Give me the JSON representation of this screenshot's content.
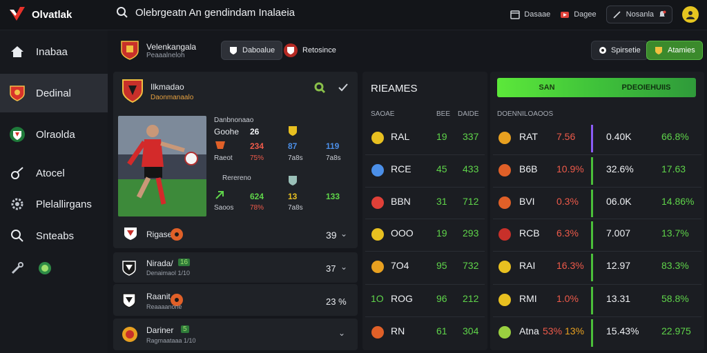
{
  "brand": {
    "name": "Olvatlak"
  },
  "search": {
    "text": "Olebrgeatn An gendindam Inalaeia"
  },
  "top_right": {
    "item1": "Dasaae",
    "item2": "Dagee",
    "item3": "Nosanla"
  },
  "sidebar": {
    "items": [
      {
        "label": "Inabaa"
      },
      {
        "label": "Dedinal"
      },
      {
        "label": "Olraolda"
      },
      {
        "label": "Atocel"
      },
      {
        "label": "Plelallirgans"
      },
      {
        "label": "Snteabs"
      },
      {
        "label": ""
      }
    ]
  },
  "subhead": {
    "team_name": "Velenkangala",
    "team_sub": "Peaaalneloh",
    "pill_active": "Daboalue",
    "pill2": "Retosince",
    "btn_dark": "Spirsetie",
    "btn_green": "Atamies"
  },
  "match_card": {
    "title": "Ilkmadao",
    "subtitle": "Daonmanaalo",
    "stats_header": "Danbnonaao",
    "goals_label": "Goohe",
    "goals_value": "26",
    "label_a": "Raeot",
    "label_b": "Saoos",
    "top_vals": [
      "234",
      "87",
      "119"
    ],
    "top_subs": [
      "75%",
      "7a8s",
      "7a8s"
    ],
    "bottom_header": "Rerereno",
    "bottom_vals": [
      "624",
      "13",
      "133"
    ],
    "bottom_subs": [
      "78%",
      "7a8s",
      ""
    ],
    "footer_label": "Rigase",
    "footer_value": "39"
  },
  "match_rows": [
    {
      "title": "Nirada/",
      "badge": "16",
      "sub": "Denaimaol 1/10",
      "value": "37"
    },
    {
      "title": "Raanit",
      "badge": "",
      "sub": "Reaaaanone",
      "value": "23 %"
    },
    {
      "title": "Dariner",
      "badge": "5",
      "sub": "Ragmaataaa 1/10",
      "value": ""
    }
  ],
  "mid_table": {
    "title": "RIEAMES",
    "headers": [
      "SAOAE",
      "BEE",
      "DAIDE"
    ],
    "rows": [
      {
        "name": "RAL",
        "a": "19",
        "b": "337",
        "badge": ""
      },
      {
        "name": "RCE",
        "a": "45",
        "b": "433",
        "badge": ""
      },
      {
        "name": "BBN",
        "a": "31",
        "b": "712",
        "badge": ""
      },
      {
        "name": "OOO",
        "a": "19",
        "b": "293",
        "badge": ""
      },
      {
        "name": "7O4",
        "a": "95",
        "b": "732",
        "badge": ""
      },
      {
        "name": "ROG",
        "a": "96",
        "b": "212",
        "badge": "1O"
      },
      {
        "name": "RN",
        "a": "61",
        "b": "304",
        "badge": ""
      }
    ]
  },
  "right_table": {
    "tab_left": "SAN",
    "tab_right": "PDEOIEHUIIS",
    "header": "DOENNILOAOOS",
    "rows": [
      {
        "name": "RAT",
        "pct": "7.56",
        "mid": "0.40K",
        "end": "66.8%",
        "bar": "#8b5cf6"
      },
      {
        "name": "B6B",
        "pct": "10.9%",
        "mid": "32.6%",
        "end": "17.63",
        "bar": "#4bbf3a"
      },
      {
        "name": "BVI",
        "pct": "0.3%",
        "mid": "06.0K",
        "end": "14.86%",
        "bar": "#4bbf3a"
      },
      {
        "name": "RCB",
        "pct": "6.3%",
        "mid": "7.007",
        "end": "13.7%",
        "bar": "#4bbf3a"
      },
      {
        "name": "RAI",
        "pct": "16.3%",
        "mid": "12.97",
        "end": "83.3%",
        "bar": "#4bbf3a"
      },
      {
        "name": "RMI",
        "pct": "1.0%",
        "mid": "13.31",
        "end": "58.8%",
        "bar": "#4bbf3a"
      },
      {
        "name": "Atna",
        "pct": "53%",
        "pct2": "13%",
        "mid": "15.43%",
        "end": "22.975",
        "bar": "#4bbf3a"
      }
    ]
  },
  "colors": {
    "accent_green": "#4bbf3a",
    "accent_red": "#ef5a4a",
    "accent_purple": "#8b5cf6"
  }
}
